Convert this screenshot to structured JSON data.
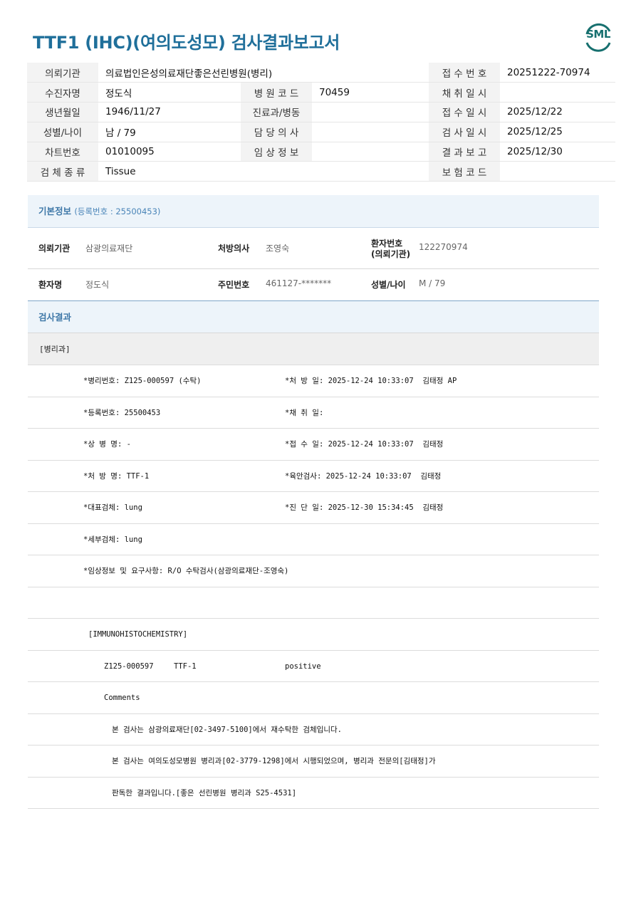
{
  "title": "TTF1 (IHC)(여의도성모) 검사결과보고서",
  "logo": {
    "text": "SML",
    "color": "#17706f"
  },
  "header_table": [
    [
      {
        "label": "의뢰기관",
        "value": "의료법인은성의료재단좋은선린병원(병리)"
      },
      {
        "label": "접 수 번 호",
        "value": "20251222-70974"
      }
    ],
    [
      {
        "label": "수진자명",
        "value": "정도식"
      },
      {
        "label": "병 원 코 드",
        "value": "70459"
      },
      {
        "label": "채 취 일 시",
        "value": ""
      }
    ],
    [
      {
        "label": "생년월일",
        "value": "1946/11/27"
      },
      {
        "label": "진료과/병동",
        "value": ""
      },
      {
        "label": "접 수 일 시",
        "value": "2025/12/22"
      }
    ],
    [
      {
        "label": "성별/나이",
        "value": "남 / 79"
      },
      {
        "label": "담 당 의 사",
        "value": ""
      },
      {
        "label": "검 사 일 시",
        "value": "2025/12/25"
      }
    ],
    [
      {
        "label": "차트번호",
        "value": "01010095"
      },
      {
        "label": "임 상 정 보",
        "value": ""
      },
      {
        "label": "결 과 보 고",
        "value": "2025/12/30"
      }
    ],
    [
      {
        "label": "검 체 종 류",
        "value": "Tissue"
      },
      {
        "label": "보 험 코 드",
        "value": ""
      }
    ]
  ],
  "basic_info": {
    "heading": "기본정보",
    "reg_no": "(등록번호 : 25500453)",
    "row1": {
      "inst_label": "의뢰기관",
      "inst_value": "삼광의료재단",
      "doctor_label": "처방의사",
      "doctor_value": "조영숙",
      "patno_label_1": "환자번호",
      "patno_label_2": "(의뢰기관)",
      "patno_value": "122270974"
    },
    "row2": {
      "name_label": "환자명",
      "name_value": "정도식",
      "rrn_label": "주민번호",
      "rrn_value": "461127-*******",
      "sexage_label": "성별/나이",
      "sexage_value": "M / 79"
    }
  },
  "results": {
    "heading": "검사결과",
    "dept": "[병리과]",
    "rows": [
      {
        "left": "*병리번호: Z125-000597 (수탁)",
        "right": "*처 방 일: 2025-12-24 10:33:07  김태정 AP"
      },
      {
        "left": "*등록번호: 25500453",
        "right": "*채 취 일:"
      },
      {
        "left": "*상 병 명: -",
        "right": "*접 수 일: 2025-12-24 10:33:07  김태정"
      },
      {
        "left": "*처 방 명: TTF-1",
        "right": "*육안검사: 2025-12-24 10:33:07  김태정"
      },
      {
        "left": "*대표검체: lung",
        "right": "*진 단 일: 2025-12-30 15:34:45  김태정"
      },
      {
        "left": "*세부검체: lung",
        "right": ""
      },
      {
        "left": "*임상정보 및 요구사항: R/O 수탁검사(삼광의료재단-조영숙)",
        "right": ""
      }
    ],
    "ihc_heading": "[IMMUNOHISTOCHEMISTRY]",
    "ihc_row": {
      "no": "Z125-000597",
      "marker": "TTF-1",
      "result": "positive"
    },
    "comments_label": "Comments",
    "comment_lines": [
      "본 검사는 삼광의료재단[02-3497-5100]에서 재수탁한 검체입니다.",
      "본 검사는 여의도성모병원 병리과[02-3779-1298]에서 시행되었으며, 병리과 전문의[김태정]가",
      "판독한 결과입니다.[좋은 선린병원 병리과 S25-4531]"
    ]
  }
}
